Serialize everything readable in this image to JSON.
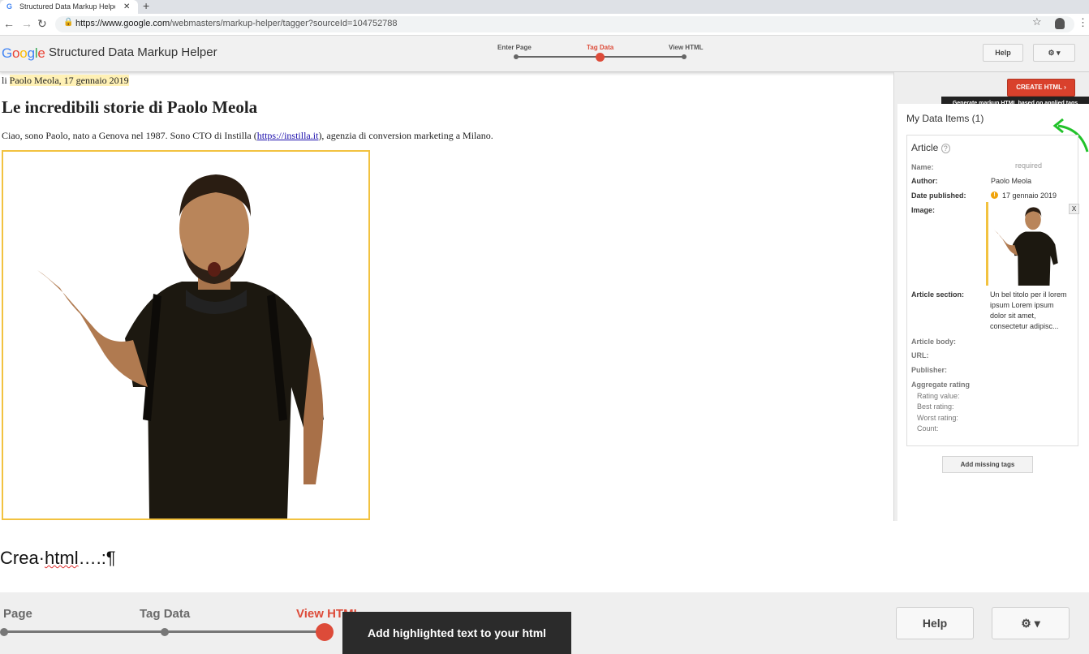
{
  "browser": {
    "tab_title": "Structured Data Markup Helpe",
    "tab_close": "✕",
    "new_tab": "+",
    "url_host": "https://www.google.com",
    "url_path": "/webmasters/markup-helper/tagger?sourceId=104752788"
  },
  "app": {
    "logo_letters": [
      "G",
      "o",
      "o",
      "g",
      "l",
      "e"
    ],
    "logo_colors": [
      "#4285f4",
      "#ea4335",
      "#fbbc05",
      "#4285f4",
      "#34a853",
      "#ea4335"
    ],
    "title": "Structured Data Markup Helper",
    "steps": [
      "Enter Page",
      "Tag Data",
      "View HTML"
    ],
    "current_step": "Tag Data",
    "help_label": "Help",
    "accent_color": "#dd4b39"
  },
  "article": {
    "byline_prefix": "li ",
    "byline_author": "Paolo Meola",
    "byline_sep": ", ",
    "byline_date": "17 gennaio 2019",
    "heading": "Le incredibili storie di Paolo Meola",
    "intro_before": "Ciao, sono Paolo, nato a Genova nel 1987. Sono CTO di Instilla (",
    "intro_link": "https://instilla.it",
    "intro_after": "), agenzia di conversion marketing a Milano."
  },
  "panel": {
    "create_html_label": "CREATE HTML",
    "create_html_chevron": "›",
    "tooltip": "Generate markup HTML based on applied tags",
    "my_data_items": "My Data Items (1)",
    "card_title": "Article",
    "help_icon": "?",
    "properties": {
      "name_label": "Name:",
      "name_value": "required",
      "author_label": "Author:",
      "author_value": "Paolo Meola",
      "date_label": "Date published:",
      "date_value": "17 gennaio 2019",
      "image_label": "Image:",
      "image_remove": "X",
      "section_label": "Article section:",
      "section_value": "Un bel titolo per il lorem ipsum Lorem ipsum dolor sit amet, consectetur adipisc...",
      "body_label": "Article body:",
      "url_label": "URL:",
      "publisher_label": "Publisher:",
      "aggregate_label": "Aggregate rating",
      "rating_value_label": "Rating value:",
      "best_rating_label": "Best rating:",
      "worst_rating_label": "Worst rating:",
      "count_label": "Count:"
    },
    "add_missing_tags": "Add missing tags"
  },
  "doc": {
    "text_1": "Crea·",
    "text_2": "html",
    "text_3": "….:¶"
  },
  "zoom": {
    "steps": [
      "Page",
      "Tag Data",
      "View HTML"
    ],
    "tooltip": "Add highlighted text to your html",
    "help_label": "Help"
  }
}
